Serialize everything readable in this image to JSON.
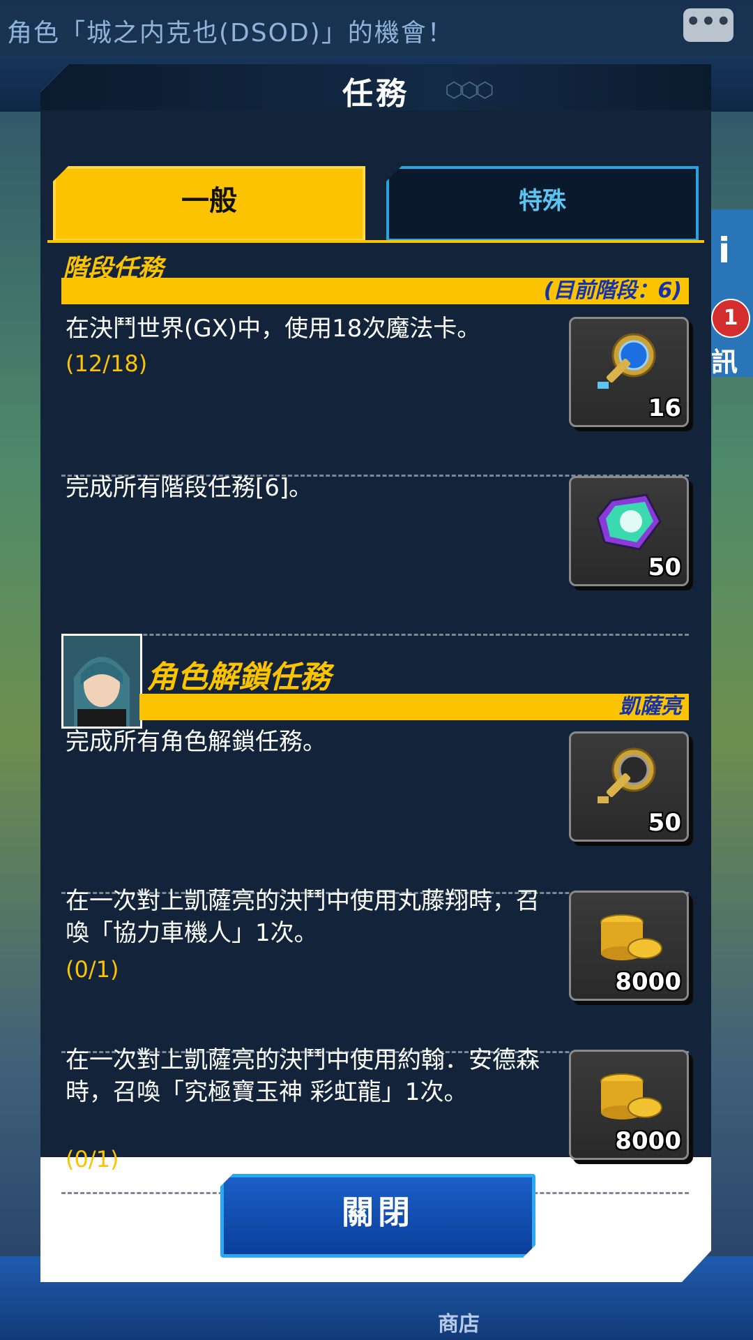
{
  "background": {
    "ticker_text": "角色「城之内克也(DSOD)」的機會！",
    "right_badge": "1",
    "right_label": "訊",
    "shop_label": "商店"
  },
  "modal": {
    "title": "任務",
    "tabs": [
      {
        "label": "一般",
        "active": true
      },
      {
        "label": "特殊",
        "active": false
      }
    ],
    "stage_section": {
      "title": "階段任務",
      "bar_text": "(目前階段：6)",
      "tasks": [
        {
          "text": "在決鬥世界(GX)中，使用18次魔法卡。",
          "progress": "(12/18)",
          "reward_icon": "key-icon",
          "reward_count": "16"
        },
        {
          "text": "完成所有階段任務[6]。",
          "progress": "",
          "reward_icon": "gem-icon",
          "reward_count": "50"
        }
      ]
    },
    "unlock_section": {
      "title": "角色解鎖任務",
      "bar_text": "凱薩亮",
      "tasks": [
        {
          "text": "完成所有角色解鎖任務。",
          "progress": "",
          "reward_icon": "key-icon",
          "reward_count": "50"
        },
        {
          "text": "在一次對上凱薩亮的決鬥中使用丸藤翔時，召喚「協力車機人」1次。",
          "progress": "(0/1)",
          "reward_icon": "gold-coins-icon",
          "reward_count": "8000"
        },
        {
          "text": "在一次對上凱薩亮的決鬥中使用約翰．安德森時，召喚「究極寶玉神 彩虹龍」1次。",
          "progress": "(0/1)",
          "reward_icon": "gold-coins-icon",
          "reward_count": "8000"
        }
      ]
    },
    "close_label": "關閉"
  },
  "colors": {
    "accent_yellow": "#fcc400",
    "panel_navy": "#13243a",
    "tab_blue": "#2aa2e0",
    "close_blue": "#0a3f9a"
  }
}
